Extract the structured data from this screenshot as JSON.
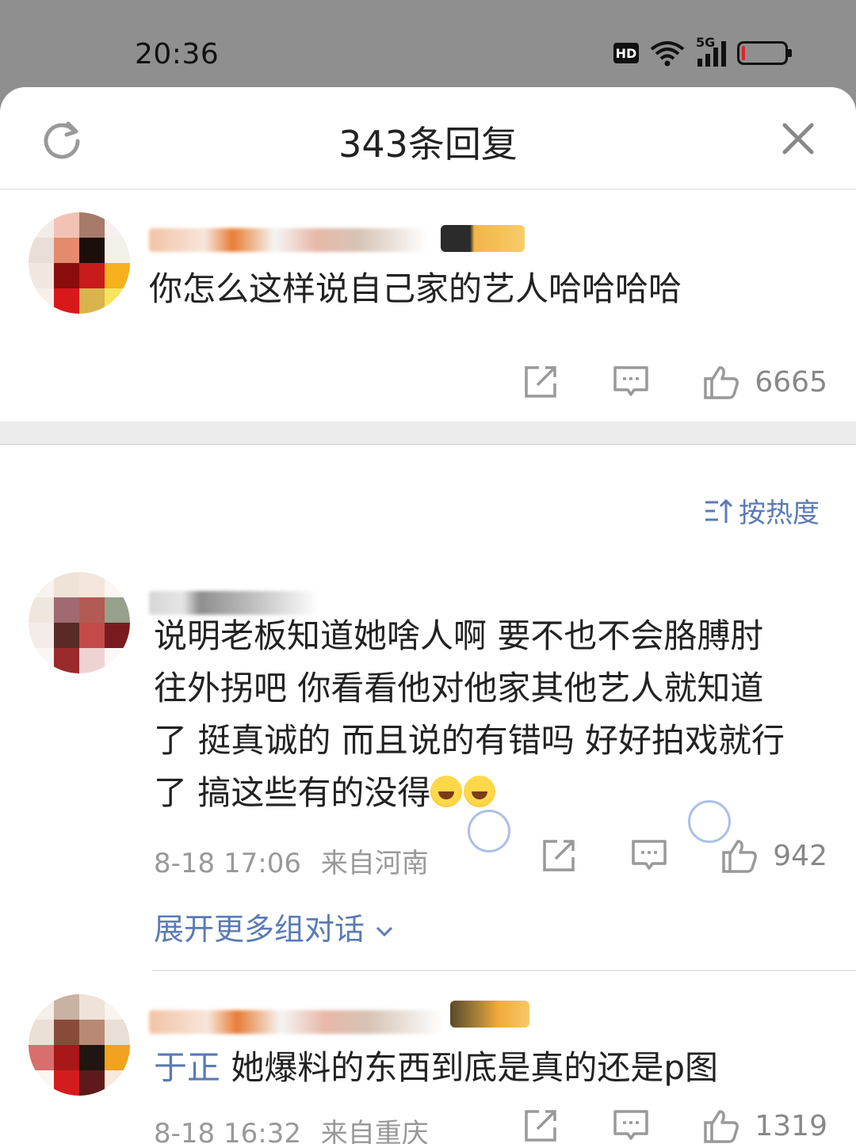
{
  "status_bar": {
    "time": "20:36",
    "hd_label": "HD",
    "network_label": "5G",
    "battery_level": 0.08,
    "battery_color": "#e0242c"
  },
  "sheet": {
    "title": "343条回复",
    "refresh_icon": "refresh-icon",
    "close_icon": "close-icon"
  },
  "root_comment": {
    "text": "你怎么这样说自己家的艺人哈哈哈哈",
    "like_count": "6665"
  },
  "sort": {
    "label": "按热度",
    "icon": "sort-icon"
  },
  "replies": [
    {
      "lines": [
        "说明老板知道她啥人啊 要不也不会胳膊肘",
        "往外拐吧 你看看他对他家其他艺人就知道",
        "了 挺真诚的 而且说的有错吗 好好拍戏就行",
        "了 搞这些有的没得"
      ],
      "emoji": [
        "laughing-crying-emoji",
        "laughing-crying-emoji"
      ],
      "time": "8-18 17:06",
      "location": "来自河南",
      "like_count": "942",
      "expand_label": "展开更多组对话"
    },
    {
      "mention": "于正",
      "text": " 她爆料的东西到底是真的还是p图",
      "time": "8-18 16:32",
      "location": "来自重庆",
      "like_count": "1319"
    }
  ],
  "colors": {
    "link": "#5a7bb5",
    "meta": "#999999",
    "status_bg": "#8f8f8f"
  }
}
